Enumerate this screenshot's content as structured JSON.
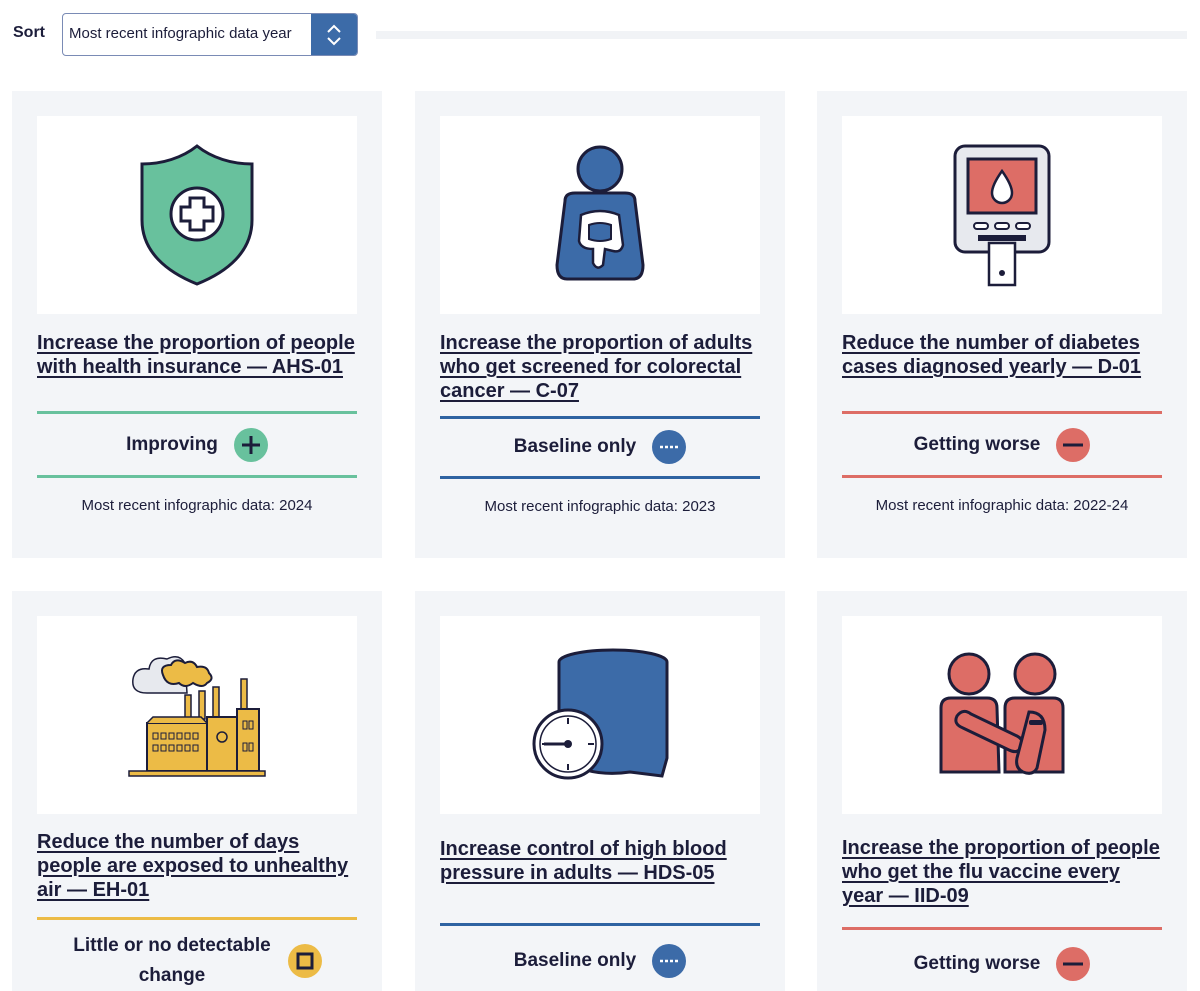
{
  "sort": {
    "label": "Sort",
    "selected": "Most recent infographic data year"
  },
  "colors": {
    "improving": "#68c19d",
    "baseline": "#2e63a2",
    "worse": "#dd6d66",
    "little_change": "#ecbb46",
    "card_bg": "#f3f5f8",
    "text": "#1c1d3a"
  },
  "cards": [
    {
      "icon": "shield-plus-icon",
      "title": "Increase the proportion of people with health insurance — AHS-01",
      "status": "Improving",
      "status_icon": "plus-icon",
      "meta": "Most recent infographic data: 2024"
    },
    {
      "icon": "person-colon-icon",
      "title": "Increase the proportion of adults who get screened for colorectal cancer — C-07",
      "status": "Baseline only",
      "status_icon": "dashed-line-icon",
      "meta": "Most recent infographic data: 2023"
    },
    {
      "icon": "glucose-meter-icon",
      "title": "Reduce the number of diabetes cases diagnosed yearly — D-01",
      "status": "Getting worse",
      "status_icon": "minus-icon",
      "meta": "Most recent infographic data: 2022-24"
    },
    {
      "icon": "factory-smoke-icon",
      "title": "Reduce the number of days people are exposed to unhealthy air — EH-01",
      "status": "Little or no detectable change",
      "status_icon": "square-icon",
      "meta": ""
    },
    {
      "icon": "blood-pressure-cuff-icon",
      "title": "Increase control of high blood pressure in adults — HDS-05",
      "status": "Baseline only",
      "status_icon": "dashed-line-icon",
      "meta": ""
    },
    {
      "icon": "vaccination-icon",
      "title": "Increase the proportion of people who get the flu vaccine every year — IID-09",
      "status": "Getting worse",
      "status_icon": "minus-icon",
      "meta": ""
    }
  ]
}
